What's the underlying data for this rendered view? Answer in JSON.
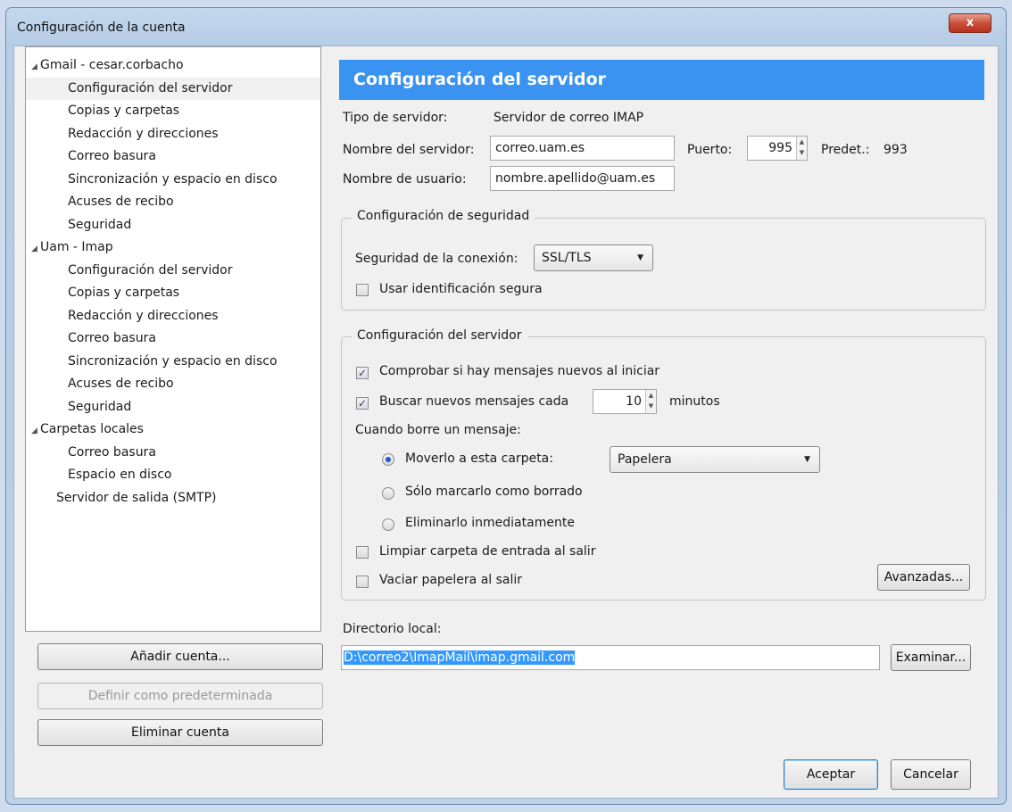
{
  "window": {
    "title": "Configuración de la cuenta",
    "close_glyph": "x"
  },
  "tree": {
    "accounts": [
      {
        "label": "Gmail - cesar.corbacho",
        "children": [
          "Configuración del servidor",
          "Copias y carpetas",
          "Redacción y direcciones",
          "Correo basura",
          "Sincronización y espacio en disco",
          "Acuses de recibo",
          "Seguridad"
        ]
      },
      {
        "label": "Uam - Imap",
        "children": [
          "Configuración del servidor",
          "Copias y carpetas",
          "Redacción y direcciones",
          "Correo basura",
          "Sincronización y espacio en disco",
          "Acuses de recibo",
          "Seguridad"
        ]
      },
      {
        "label": "Carpetas locales",
        "children": [
          "Correo basura",
          "Espacio en disco"
        ]
      }
    ],
    "smtp": "Servidor de salida (SMTP)",
    "selected": "Configuración del servidor"
  },
  "left_buttons": {
    "add": "Añadir cuenta...",
    "set_default": "Definir como predeterminada",
    "delete": "Eliminar cuenta"
  },
  "header": "Configuración del servidor",
  "server": {
    "type_label": "Tipo de servidor:",
    "type_value": "Servidor de correo IMAP",
    "name_label": "Nombre del servidor:",
    "name_value": "correo.uam.es",
    "port_label": "Puerto:",
    "port_value": "995",
    "default_label": "Predet.:",
    "default_value": "993",
    "user_label": "Nombre de usuario:",
    "user_value": "nombre.apellido@uam.es"
  },
  "security": {
    "legend": "Configuración de seguridad",
    "conn_label": "Seguridad de la conexión:",
    "conn_value": "SSL/TLS",
    "secure_auth_label": "Usar identificación segura",
    "secure_auth_checked": false
  },
  "server_settings": {
    "legend": "Configuración del servidor",
    "check_startup_label": "Comprobar si hay mensajes nuevos al iniciar",
    "check_startup_checked": true,
    "check_every_label": "Buscar nuevos mensajes cada",
    "check_every_checked": true,
    "check_every_value": "10",
    "minutes_label": "minutos",
    "delete_label": "Cuando borre un mensaje:",
    "move_label": "Moverlo a esta carpeta:",
    "move_folder": "Papelera",
    "mark_label": "Sólo marcarlo como borrado",
    "remove_label": "Eliminarlo inmediatamente",
    "selected_option": "move",
    "clean_inbox_label": "Limpiar carpeta de entrada al salir",
    "clean_inbox_checked": false,
    "empty_trash_label": "Vaciar papelera al salir",
    "empty_trash_checked": false,
    "advanced_button": "Avanzadas..."
  },
  "local_dir": {
    "label": "Directorio local:",
    "value": "D:\\correo2\\ImapMail\\imap.gmail.com",
    "browse_button": "Examinar..."
  },
  "footer": {
    "accept": "Aceptar",
    "cancel": "Cancelar"
  },
  "icons": {
    "check": "✓",
    "spin_up": "▲",
    "spin_down": "▼",
    "dropdown": "▼",
    "expand": "◢"
  }
}
